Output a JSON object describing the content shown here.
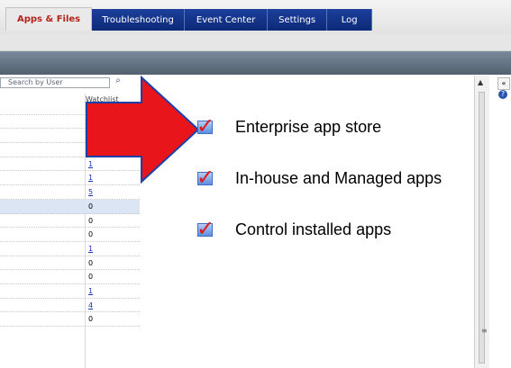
{
  "tabs": [
    {
      "label": "Apps & Files",
      "active": true
    },
    {
      "label": "Troubleshooting"
    },
    {
      "label": "Event Center"
    },
    {
      "label": "Settings"
    },
    {
      "label": "Log"
    }
  ],
  "left_panel": {
    "search_placeholder": "Search by User",
    "search_icon": "search-icon",
    "column_header": "Watchlist",
    "rows": [
      {
        "value": ""
      },
      {
        "value": ""
      },
      {
        "value": ""
      },
      {
        "value": "0"
      },
      {
        "value": "1",
        "link": true
      },
      {
        "value": "1",
        "link": true
      },
      {
        "value": "5",
        "link": true
      },
      {
        "value": "0",
        "selected": true
      },
      {
        "value": "0"
      },
      {
        "value": "0"
      },
      {
        "value": "1",
        "link": true
      },
      {
        "value": "0"
      },
      {
        "value": "0"
      },
      {
        "value": "1",
        "link": true
      },
      {
        "value": "4",
        "link": true
      },
      {
        "value": "0"
      }
    ]
  },
  "right_rail": {
    "collapse_label": "«",
    "help_label": "?",
    "scroll_up": "▲",
    "scroll_grip": "≡"
  },
  "checklist": [
    {
      "label": "Enterprise app store"
    },
    {
      "label": "In-house and Managed apps"
    },
    {
      "label": "Control installed apps"
    }
  ],
  "colors": {
    "arrow": "#e8161b",
    "arrow_outline": "#1d3fa8",
    "tab_blue": "#0d2a78",
    "active_tab_text": "#b3241c"
  }
}
